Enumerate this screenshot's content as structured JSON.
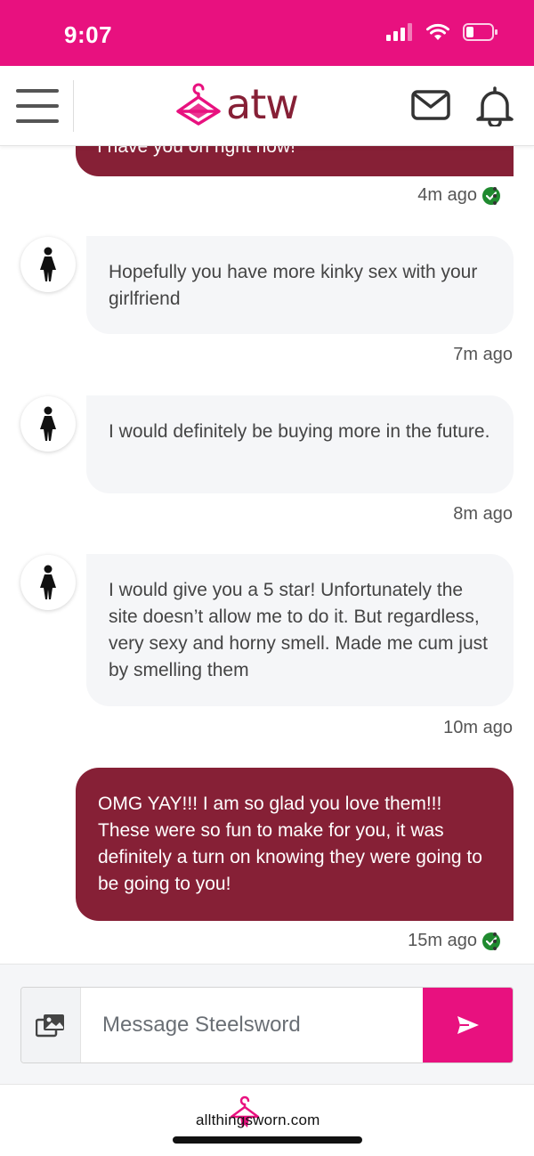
{
  "status_bar": {
    "time": "9:07",
    "icons": [
      "signal-icon",
      "wifi-icon",
      "battery-icon"
    ]
  },
  "nav": {
    "logo_text": "atw",
    "icons": [
      "hamburger-menu-icon",
      "mail-icon",
      "bell-icon"
    ]
  },
  "messages": [
    {
      "direction": "out",
      "text": "I have you on right now!",
      "time": "4m ago",
      "read": true
    },
    {
      "direction": "in",
      "text": "Hopefully you have more kinky sex with your girlfriend",
      "time": "7m ago"
    },
    {
      "direction": "in",
      "text": "I would definitely be buying more in the future.",
      "time": "8m ago"
    },
    {
      "direction": "in",
      "text": "I would give you a 5 star! Unfortunately the site doesn’t allow me to do it. But regardless, very sexy and horny smell. Made me cum just by smelling them",
      "time": "10m ago"
    },
    {
      "direction": "out",
      "text": "OMG YAY!!! I am so glad you love them!!! These were so fun to make for you, it was definitely a turn on knowing they were going to be going to you!",
      "time": "15m ago",
      "read": true
    }
  ],
  "composer": {
    "placeholder": "Message Steelsword",
    "value": ""
  },
  "footer": {
    "site_text": "allthingsworn.com"
  },
  "colors": {
    "brand_pink": "#e8117f",
    "brand_maroon": "#862036",
    "incoming_bubble": "#f5f6f8",
    "read_check": "#1f8a2f"
  }
}
